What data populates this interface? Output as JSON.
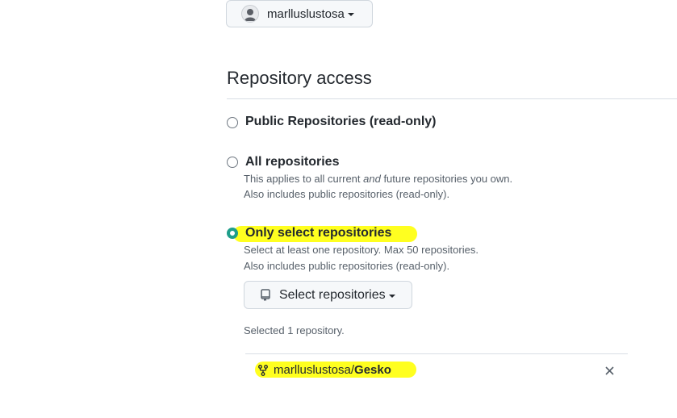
{
  "owner": {
    "name": "marlluslustosa",
    "avatar_icon": "user-avatar"
  },
  "repository_access": {
    "title": "Repository access",
    "options": [
      {
        "label": "Public Repositories (read-only)",
        "checked": false,
        "notes": []
      },
      {
        "label": "All repositories",
        "checked": false,
        "notes_parts": {
          "before": "This applies to all current ",
          "emphasis": "and",
          "after": " future repositories you own."
        },
        "notes": [
          "Also includes public repositories (read-only)."
        ]
      },
      {
        "label": "Only select repositories",
        "checked": true,
        "notes": [
          "Select at least one repository. Max 50 repositories.",
          "Also includes public repositories (read-only)."
        ]
      }
    ],
    "select_button": {
      "label": "Select repositories",
      "icon": "repo-icon"
    },
    "selected_count_text": "Selected 1 repository.",
    "selected_repos": [
      {
        "owner": "marlluslustosa/",
        "name": "Gesko",
        "icon": "repo-forked-icon"
      }
    ]
  },
  "colors": {
    "accent_radio": "#1f9e8a",
    "highlight": "#ffff20"
  }
}
